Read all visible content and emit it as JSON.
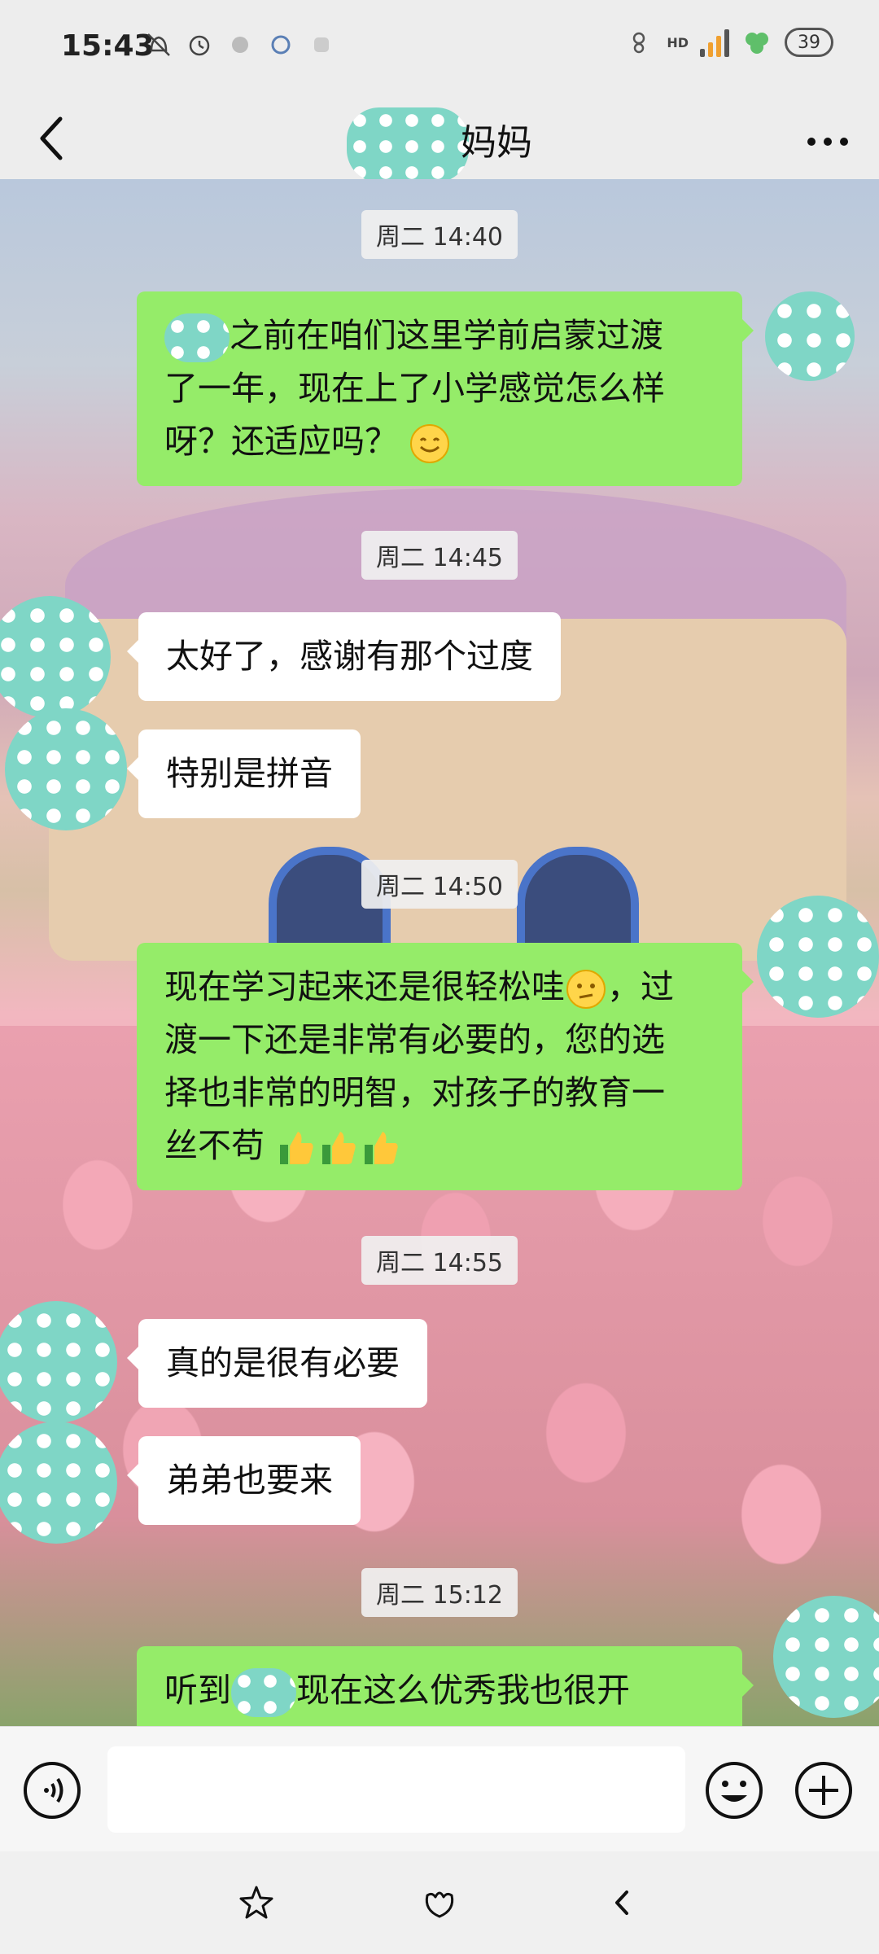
{
  "status_bar": {
    "time": "15:43",
    "network": "HD",
    "battery": "39"
  },
  "header": {
    "title": "妈妈"
  },
  "messages": [
    {
      "type": "timestamp",
      "text": "周二 14:40"
    },
    {
      "type": "sent",
      "lines": [
        "之前在咱们这里学前启蒙过渡",
        "了一年，现在上了小学感觉怎么样",
        "呀？还适应吗？"
      ]
    },
    {
      "type": "timestamp",
      "text": "周二 14:45"
    },
    {
      "type": "received",
      "text": "太好了，感谢有那个过度"
    },
    {
      "type": "received",
      "text": "特别是拼音"
    },
    {
      "type": "timestamp",
      "text": "周二 14:50"
    },
    {
      "type": "sent",
      "lines": [
        "现在学习起来还是很轻松哇",
        "，过",
        "渡一下还是非常有必要的，您的选",
        "择也非常的明智，对孩子的教育一",
        "丝不苟"
      ]
    },
    {
      "type": "timestamp",
      "text": "周二 14:55"
    },
    {
      "type": "received",
      "text": "真的是很有必要"
    },
    {
      "type": "received",
      "text": "弟弟也要来"
    },
    {
      "type": "timestamp",
      "text": "周二 15:12"
    },
    {
      "type": "sent",
      "lines": [
        "听到",
        "现在这么优秀我也很开"
      ]
    }
  ],
  "input": {
    "value": "",
    "placeholder": ""
  },
  "colors": {
    "sent_bubble": "#95ec69",
    "received_bubble": "#ffffff",
    "avatar_mask": "#7fd6c6"
  },
  "icons": [
    "do-not-disturb-icon",
    "alarm-icon",
    "voice-icon",
    "emoji-icon",
    "plus-icon",
    "star-icon",
    "home-icon",
    "back-nav-icon"
  ]
}
